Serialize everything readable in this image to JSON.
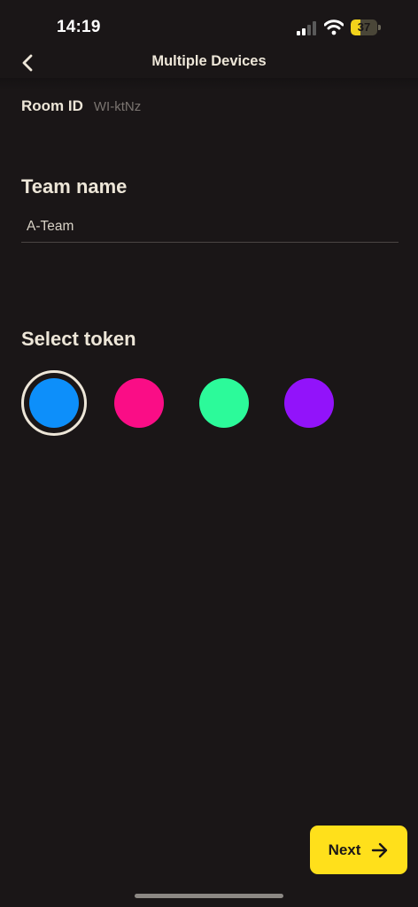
{
  "status_bar": {
    "time": "14:19",
    "battery_level": "37",
    "battery_fraction": 0.37,
    "icons": [
      "signal-icon",
      "wifi-icon",
      "battery-icon"
    ]
  },
  "header": {
    "title": "Multiple Devices",
    "back_icon": "chevron-left-icon"
  },
  "room": {
    "label": "Room ID",
    "value": "WI-ktNz"
  },
  "team": {
    "heading": "Team name",
    "input_value": "A-Team"
  },
  "tokens": {
    "heading": "Select token",
    "selected_index": 0,
    "options": [
      {
        "color": "#0d8ffa"
      },
      {
        "color": "#fa0d86"
      },
      {
        "color": "#2cfa9a"
      },
      {
        "color": "#9213fa"
      }
    ]
  },
  "footer": {
    "next_label": "Next",
    "next_icon": "arrow-right-icon"
  },
  "colors": {
    "background": "#1a1617",
    "accent": "#ffe01b",
    "text": "#ede6d8"
  }
}
